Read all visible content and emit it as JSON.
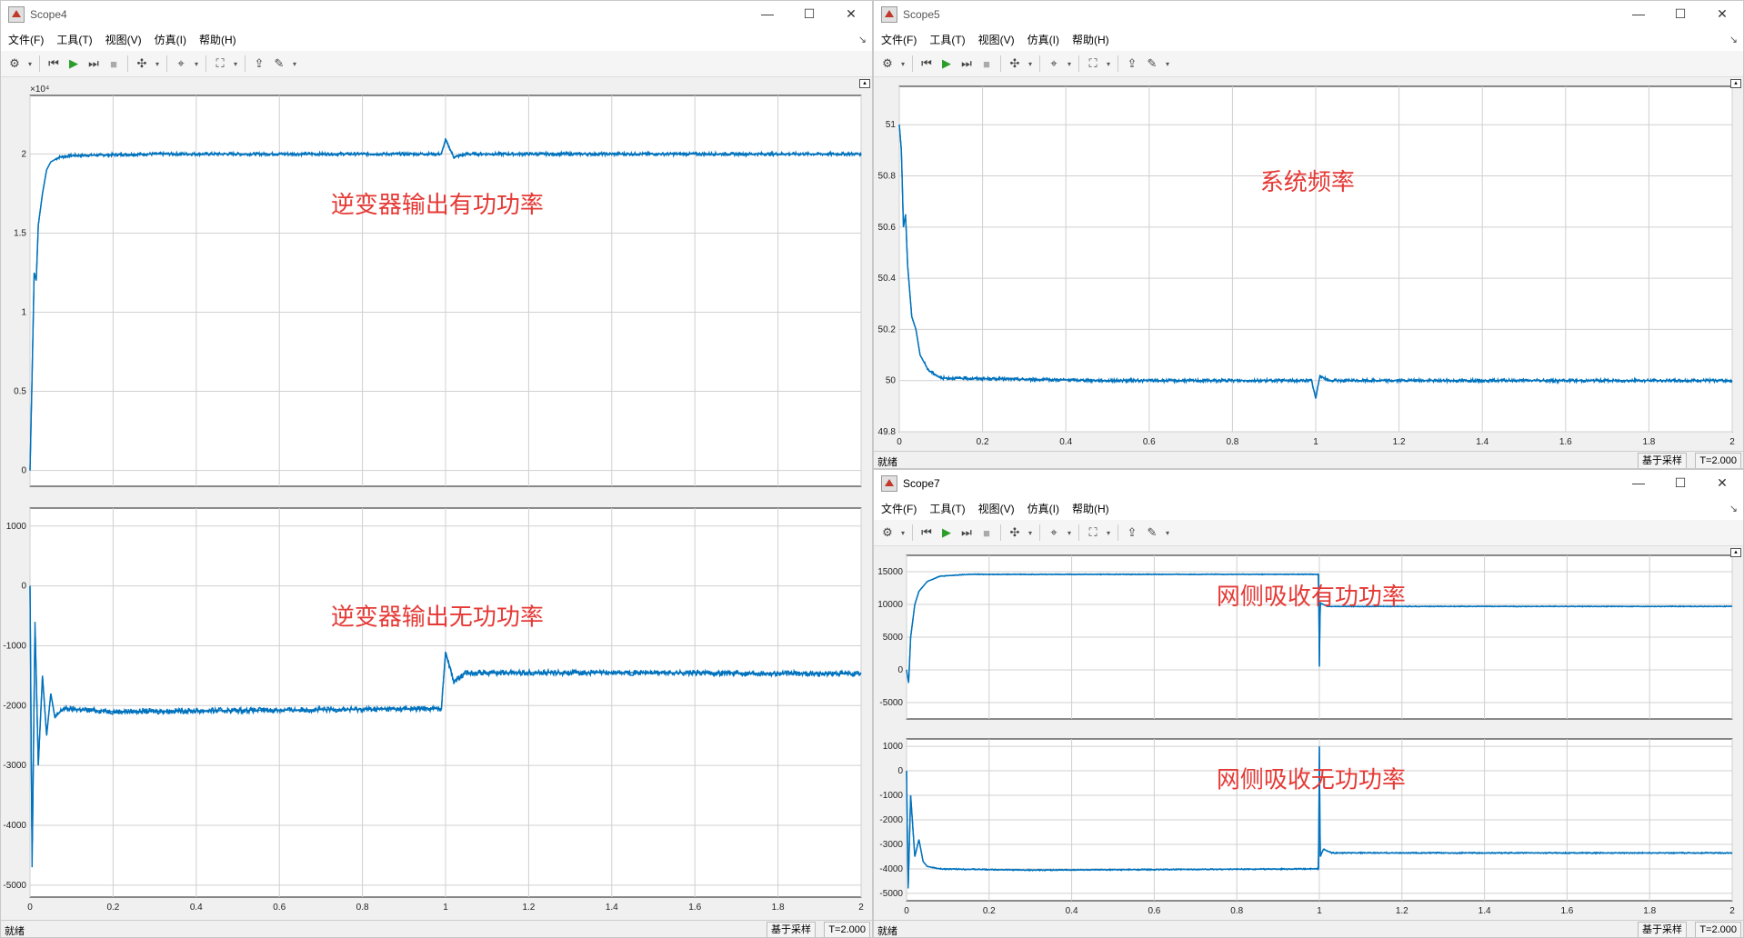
{
  "menu": [
    "文件(F)",
    "工具(T)",
    "视图(V)",
    "仿真(I)",
    "帮助(H)"
  ],
  "status": {
    "ready": "就绪",
    "sample_based": "基于采样",
    "time": "T=2.000"
  },
  "window_controls": {
    "minimize": "—",
    "maximize": "☐",
    "close": "✕"
  },
  "windows": {
    "scope4": {
      "title": "Scope4"
    },
    "scope5": {
      "title": "Scope5"
    },
    "scope7": {
      "title": "Scope7"
    }
  },
  "chart_data": [
    {
      "id": "scope4_top",
      "type": "line",
      "annotation": "逆变器输出有功功率",
      "exponent_label": "×10⁴",
      "xlim": [
        0,
        2
      ],
      "ylim": [
        -0.1,
        2.37
      ],
      "xticks": [
        0,
        0.2,
        0.4,
        0.6,
        0.8,
        1,
        1.2,
        1.4,
        1.6,
        1.8,
        2
      ],
      "yticks": [
        0,
        0.5,
        1,
        1.5,
        2
      ],
      "ytick_labels": [
        "0",
        "0.5",
        "1",
        "1.5",
        "2"
      ],
      "show_xtick_labels": false,
      "series": [
        {
          "color": "#0072bd",
          "points": [
            [
              0,
              0
            ],
            [
              0.005,
              0.6
            ],
            [
              0.01,
              1.25
            ],
            [
              0.015,
              1.2
            ],
            [
              0.02,
              1.55
            ],
            [
              0.03,
              1.75
            ],
            [
              0.04,
              1.9
            ],
            [
              0.05,
              1.95
            ],
            [
              0.07,
              1.98
            ],
            [
              0.1,
              1.99
            ],
            [
              0.3,
              2.0
            ],
            [
              0.6,
              2.0
            ],
            [
              0.99,
              2.0
            ],
            [
              1.0,
              2.09
            ],
            [
              1.02,
              1.98
            ],
            [
              1.05,
              2.0
            ],
            [
              1.5,
              2.0
            ],
            [
              2.0,
              2.0
            ]
          ],
          "noise": 0.01
        }
      ]
    },
    {
      "id": "scope4_bottom",
      "type": "line",
      "annotation": "逆变器输出无功功率",
      "xlim": [
        0,
        2
      ],
      "ylim": [
        -5200,
        1300
      ],
      "xticks": [
        0,
        0.2,
        0.4,
        0.6,
        0.8,
        1,
        1.2,
        1.4,
        1.6,
        1.8,
        2
      ],
      "xtick_labels": [
        "0",
        "0.2",
        "0.4",
        "0.6",
        "0.8",
        "1",
        "1.2",
        "1.4",
        "1.6",
        "1.8",
        "2"
      ],
      "yticks": [
        -5000,
        -4000,
        -3000,
        -2000,
        -1000,
        0,
        1000
      ],
      "ytick_labels": [
        "-5000",
        "-4000",
        "-3000",
        "-2000",
        "-1000",
        "0",
        "1000"
      ],
      "series": [
        {
          "color": "#0072bd",
          "points": [
            [
              0,
              0
            ],
            [
              0.005,
              -4700
            ],
            [
              0.012,
              -600
            ],
            [
              0.02,
              -3000
            ],
            [
              0.03,
              -1500
            ],
            [
              0.04,
              -2500
            ],
            [
              0.05,
              -1800
            ],
            [
              0.06,
              -2200
            ],
            [
              0.08,
              -2050
            ],
            [
              0.2,
              -2100
            ],
            [
              0.5,
              -2080
            ],
            [
              0.99,
              -2050
            ],
            [
              1.0,
              -1100
            ],
            [
              1.02,
              -1600
            ],
            [
              1.05,
              -1450
            ],
            [
              1.5,
              -1450
            ],
            [
              2.0,
              -1470
            ]
          ],
          "noise": 45
        }
      ]
    },
    {
      "id": "scope5",
      "type": "line",
      "annotation": "系统频率",
      "xlim": [
        0,
        2
      ],
      "ylim": [
        49.8,
        51.15
      ],
      "xticks": [
        0,
        0.2,
        0.4,
        0.6,
        0.8,
        1,
        1.2,
        1.4,
        1.6,
        1.8,
        2
      ],
      "xtick_labels": [
        "0",
        "0.2",
        "0.4",
        "0.6",
        "0.8",
        "1",
        "1.2",
        "1.4",
        "1.6",
        "1.8",
        "2"
      ],
      "yticks": [
        49.8,
        50,
        50.2,
        50.4,
        50.6,
        50.8,
        51
      ],
      "ytick_labels": [
        "49.8",
        "50",
        "50.2",
        "50.4",
        "50.6",
        "50.8",
        "51"
      ],
      "series": [
        {
          "color": "#0072bd",
          "points": [
            [
              0,
              51.0
            ],
            [
              0.005,
              50.9
            ],
            [
              0.01,
              50.6
            ],
            [
              0.015,
              50.65
            ],
            [
              0.02,
              50.45
            ],
            [
              0.03,
              50.25
            ],
            [
              0.04,
              50.2
            ],
            [
              0.05,
              50.1
            ],
            [
              0.07,
              50.04
            ],
            [
              0.1,
              50.01
            ],
            [
              0.5,
              50.0
            ],
            [
              0.99,
              50.0
            ],
            [
              1.0,
              49.93
            ],
            [
              1.01,
              50.02
            ],
            [
              1.03,
              50.0
            ],
            [
              2.0,
              50.0
            ]
          ],
          "noise": 0.006
        }
      ]
    },
    {
      "id": "scope7_top",
      "type": "line",
      "annotation": "网侧吸收有功功率",
      "xlim": [
        0,
        2
      ],
      "ylim": [
        -7500,
        17500
      ],
      "xticks": [
        0,
        0.2,
        0.4,
        0.6,
        0.8,
        1,
        1.2,
        1.4,
        1.6,
        1.8,
        2
      ],
      "show_xtick_labels": false,
      "yticks": [
        -5000,
        0,
        5000,
        10000,
        15000
      ],
      "ytick_labels": [
        "-5000",
        "0",
        "5000",
        "10000",
        "15000"
      ],
      "series": [
        {
          "color": "#0072bd",
          "points": [
            [
              0,
              0
            ],
            [
              0.005,
              -2000
            ],
            [
              0.01,
              5000
            ],
            [
              0.02,
              10000
            ],
            [
              0.03,
              12000
            ],
            [
              0.05,
              13500
            ],
            [
              0.08,
              14300
            ],
            [
              0.15,
              14600
            ],
            [
              0.5,
              14600
            ],
            [
              0.998,
              14600
            ],
            [
              1.0,
              500
            ],
            [
              1.002,
              10200
            ],
            [
              1.02,
              9700
            ],
            [
              1.5,
              9700
            ],
            [
              2.0,
              9700
            ]
          ],
          "noise": 60
        }
      ]
    },
    {
      "id": "scope7_bottom",
      "type": "line",
      "annotation": "网侧吸收无功功率",
      "xlim": [
        0,
        2
      ],
      "ylim": [
        -5300,
        1300
      ],
      "xticks": [
        0,
        0.2,
        0.4,
        0.6,
        0.8,
        1,
        1.2,
        1.4,
        1.6,
        1.8,
        2
      ],
      "xtick_labels": [
        "0",
        "0.2",
        "0.4",
        "0.6",
        "0.8",
        "1",
        "1.2",
        "1.4",
        "1.6",
        "1.8",
        "2"
      ],
      "yticks": [
        -5000,
        -4000,
        -3000,
        -2000,
        -1000,
        0,
        1000
      ],
      "ytick_labels": [
        "-5000",
        "-4000",
        "-3000",
        "-2000",
        "-1000",
        "0",
        "1000"
      ],
      "series": [
        {
          "color": "#0072bd",
          "points": [
            [
              0,
              0
            ],
            [
              0.004,
              -4800
            ],
            [
              0.01,
              -1000
            ],
            [
              0.02,
              -3500
            ],
            [
              0.03,
              -2800
            ],
            [
              0.04,
              -3700
            ],
            [
              0.05,
              -3900
            ],
            [
              0.08,
              -4000
            ],
            [
              0.3,
              -4050
            ],
            [
              0.998,
              -4000
            ],
            [
              1.0,
              1000
            ],
            [
              1.002,
              -3500
            ],
            [
              1.01,
              -3200
            ],
            [
              1.03,
              -3350
            ],
            [
              2.0,
              -3350
            ]
          ],
          "noise": 25
        }
      ]
    }
  ]
}
